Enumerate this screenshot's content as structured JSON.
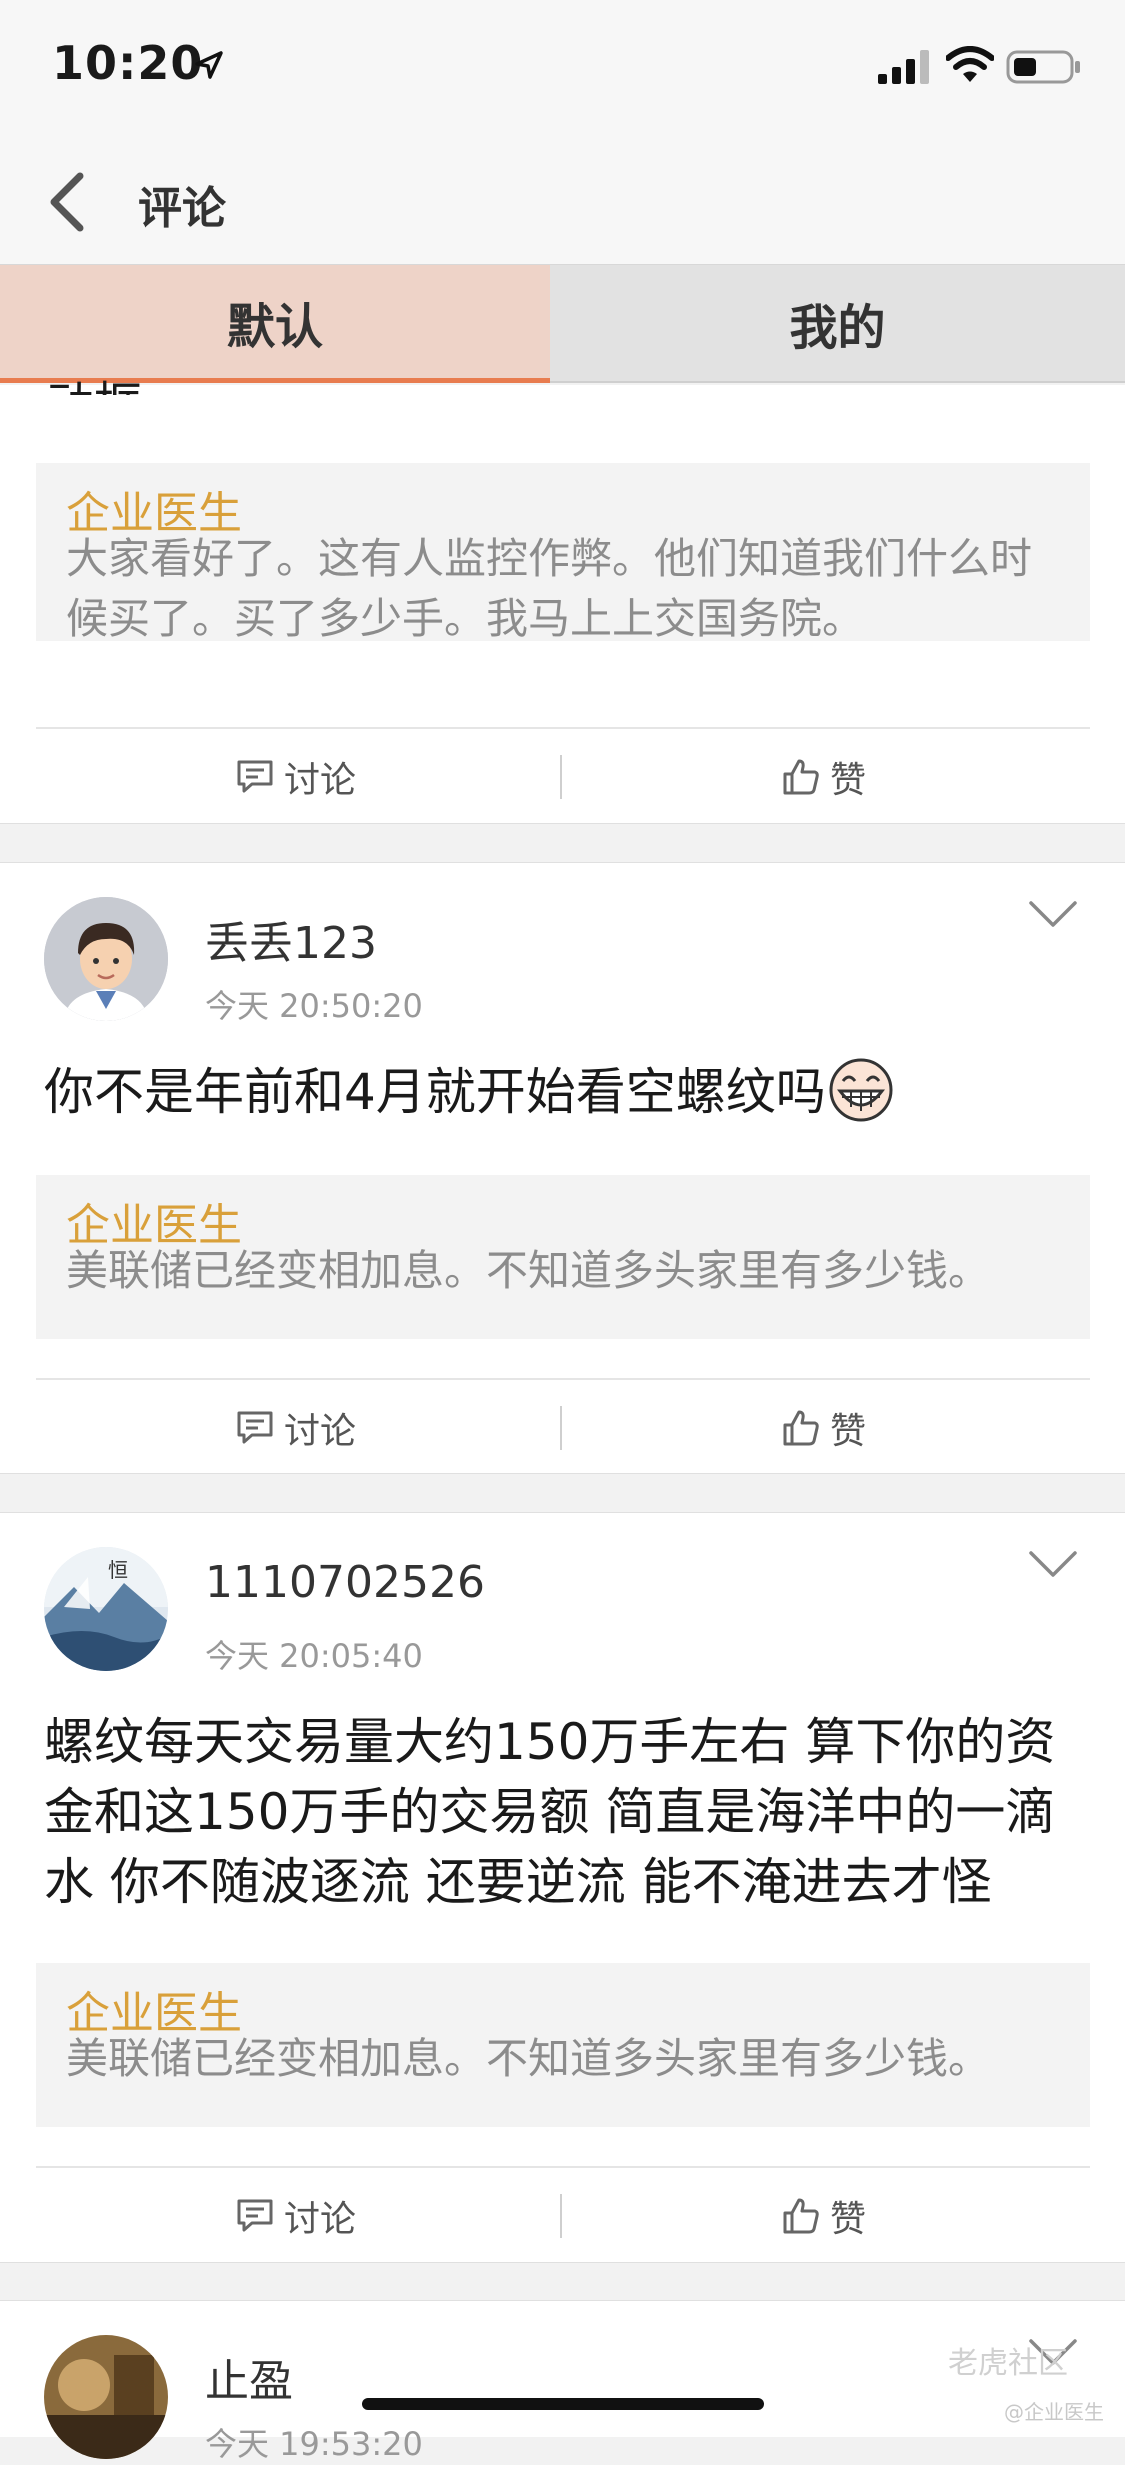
{
  "status_bar": {
    "time": "10:20"
  },
  "nav": {
    "title": "评论"
  },
  "tabs": [
    {
      "label": "默认"
    },
    {
      "label": "我的"
    }
  ],
  "partial_top_text": "动框",
  "actions": {
    "discuss_label": "讨论",
    "like_label": "赞"
  },
  "posts": [
    {
      "quote": {
        "author": "企业医生",
        "text": "大家看好了。这有人监控作弊。他们知道我们什么时候买了。买了多少手。我马上上交国务院。"
      }
    },
    {
      "user": "丢丢123",
      "time": "今天 20:50:20",
      "content": "你不是年前和4月就开始看空螺纹吗",
      "quote": {
        "author": "企业医生",
        "text": "美联储已经变相加息。不知道多头家里有多少钱。"
      }
    },
    {
      "user": "1110702526",
      "time": "今天 20:05:40",
      "content": "螺纹每天交易量大约150万手左右 算下你的资金和这150万手的交易额 简直是海洋中的一滴水 你不随波逐流 还要逆流 能不淹进去才怪",
      "quote": {
        "author": "企业医生",
        "text": "美联储已经变相加息。不知道多头家里有多少钱。"
      }
    },
    {
      "user": "止盈",
      "time": "今天 19:53:20"
    }
  ],
  "watermark": {
    "brand": "老虎社区",
    "handle": "@企业医生"
  },
  "colors": {
    "accent": "#e87c4f",
    "quote_author": "#d9a03a",
    "tab_active_bg": "#eed3c8"
  }
}
